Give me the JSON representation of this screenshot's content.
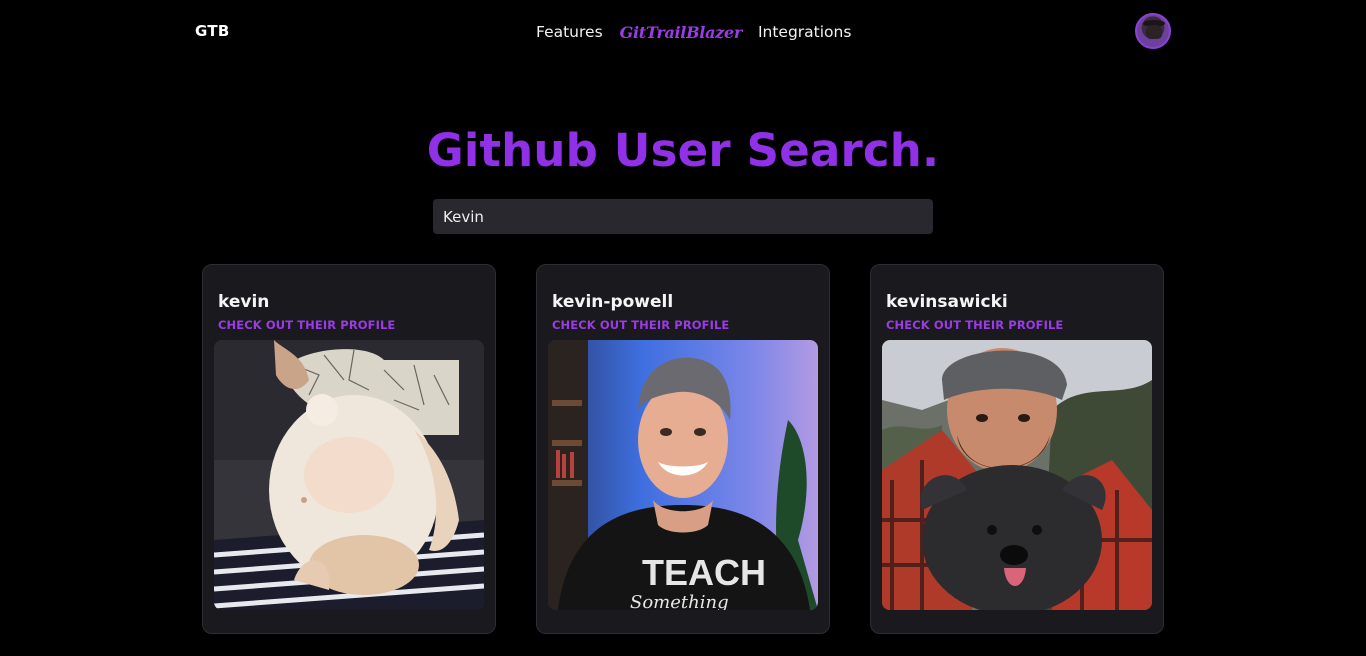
{
  "nav": {
    "brand": "GTB",
    "links": [
      {
        "label": "Features"
      },
      {
        "label": "GitTrailBlazer"
      },
      {
        "label": "Integrations"
      }
    ],
    "avatar_icon": "user-avatar-icon"
  },
  "main": {
    "title": "Github User Search.",
    "search": {
      "value": "Kevin",
      "placeholder": ""
    }
  },
  "results": [
    {
      "username": "kevin",
      "link_label": "CHECK OUT THEIR PROFILE",
      "photo": "kitten-with-manga-photo"
    },
    {
      "username": "kevin-powell",
      "link_label": "CHECK OUT THEIR PROFILE",
      "photo": "smiling-man-teach-shirt-photo"
    },
    {
      "username": "kevinsawicki",
      "link_label": "CHECK OUT THEIR PROFILE",
      "photo": "man-with-dog-photo"
    }
  ],
  "colors": {
    "background": "#000000",
    "accent": "#9031e8",
    "card": "#1a191d",
    "input": "#2a282f"
  }
}
